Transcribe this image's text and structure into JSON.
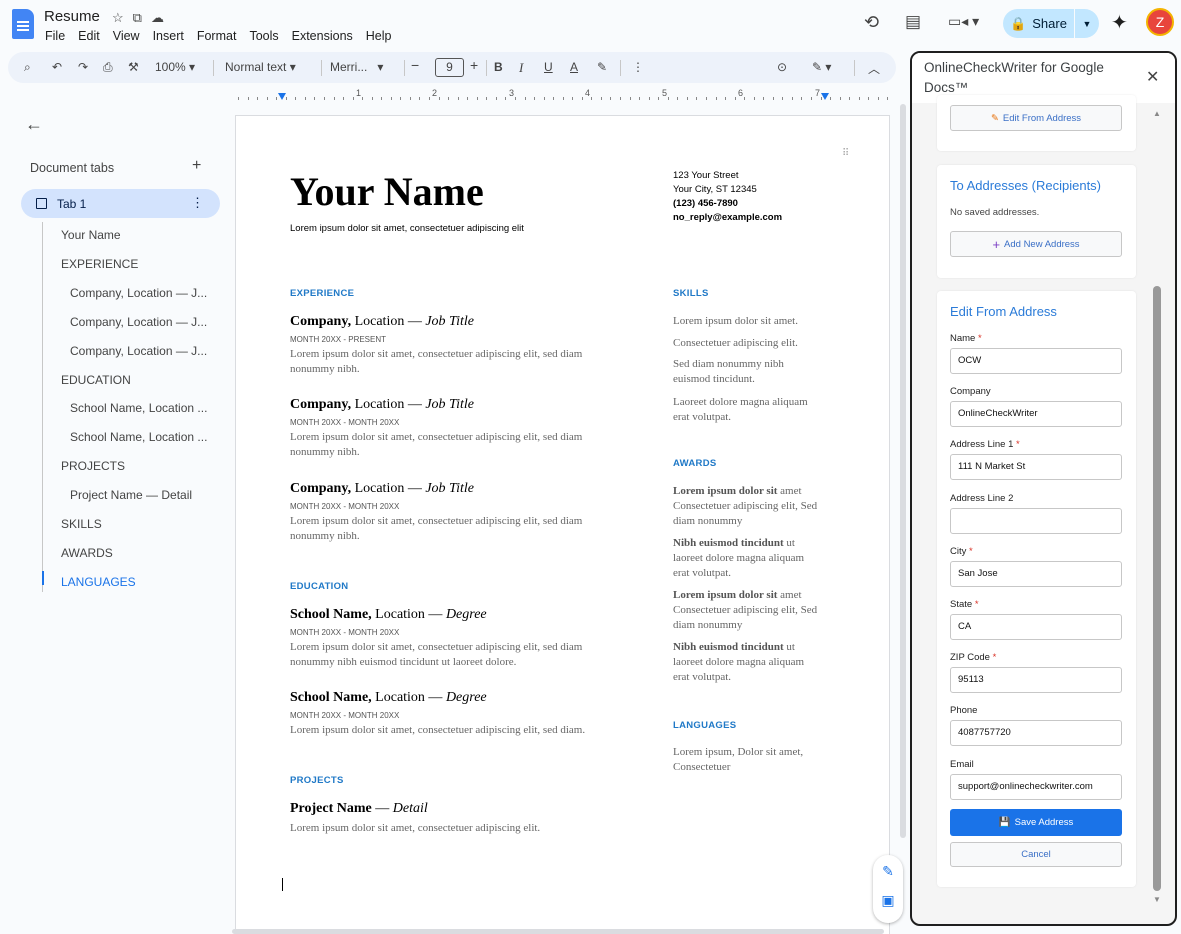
{
  "app": {
    "doc_title": "Resume",
    "menus": [
      "File",
      "Edit",
      "View",
      "Insert",
      "Format",
      "Tools",
      "Extensions",
      "Help"
    ],
    "share_label": "Share",
    "avatar_letter": "Z"
  },
  "toolbar": {
    "zoom": "100%",
    "style": "Normal text",
    "font": "Merri...",
    "font_size": "9"
  },
  "ruler": {
    "marks": [
      "1",
      "2",
      "3",
      "4",
      "5",
      "6",
      "7"
    ]
  },
  "left_pane": {
    "heading": "Document tabs",
    "tab_label": "Tab 1",
    "outline": [
      {
        "label": "Your Name",
        "level": 1
      },
      {
        "label": "EXPERIENCE",
        "level": 1
      },
      {
        "label": "Company, Location — J...",
        "level": 2
      },
      {
        "label": "Company, Location — J...",
        "level": 2
      },
      {
        "label": "Company, Location — J...",
        "level": 2
      },
      {
        "label": "EDUCATION",
        "level": 1
      },
      {
        "label": "School Name, Location ...",
        "level": 2
      },
      {
        "label": "School Name, Location ...",
        "level": 2
      },
      {
        "label": "PROJECTS",
        "level": 1
      },
      {
        "label": "Project Name — Detail",
        "level": 2
      },
      {
        "label": "SKILLS",
        "level": 1
      },
      {
        "label": "AWARDS",
        "level": 1
      },
      {
        "label": "LANGUAGES",
        "level": 1
      }
    ]
  },
  "doc": {
    "name": "Your Name",
    "tagline": "Lorem ipsum dolor sit amet, consectetuer adipiscing elit",
    "contact": [
      "123 Your Street",
      "Your City, ST 12345",
      "(123) 456-7890",
      "no_reply@example.com"
    ],
    "experience_head": "EXPERIENCE",
    "jobs": [
      {
        "company": "Company,",
        "location": " Location — ",
        "title": "Job Title",
        "dates": "MONTH 20XX - PRESENT",
        "desc": "Lorem ipsum dolor sit amet, consectetuer adipiscing elit, sed diam nonummy nibh."
      },
      {
        "company": "Company,",
        "location": " Location — ",
        "title": "Job Title",
        "dates": "MONTH 20XX - MONTH 20XX",
        "desc": "Lorem ipsum dolor sit amet, consectetuer adipiscing elit, sed diam nonummy nibh."
      },
      {
        "company": "Company,",
        "location": " Location — ",
        "title": "Job Title",
        "dates": "MONTH 20XX - MONTH 20XX",
        "desc": "Lorem ipsum dolor sit amet, consectetuer adipiscing elit, sed diam nonummy nibh."
      }
    ],
    "education_head": "EDUCATION",
    "schools": [
      {
        "school": "School Name,",
        "location": " Location — ",
        "degree": "Degree",
        "dates": "MONTH 20XX - MONTH 20XX",
        "desc": "Lorem ipsum dolor sit amet, consectetuer adipiscing elit, sed diam nonummy nibh euismod tincidunt ut laoreet dolore."
      },
      {
        "school": "School Name,",
        "location": " Location — ",
        "degree": "Degree",
        "dates": "MONTH 20XX - MONTH 20XX",
        "desc": "Lorem ipsum dolor sit amet, consectetuer adipiscing elit, sed diam."
      }
    ],
    "projects_head": "PROJECTS",
    "project": {
      "name": "Project Name",
      "detail": " — ",
      "detail_italic": "Detail",
      "desc": "Lorem ipsum dolor sit amet, consectetuer adipiscing elit."
    },
    "skills_head": "SKILLS",
    "skills": [
      "Lorem ipsum dolor sit amet.",
      "Consectetuer adipiscing elit.",
      "Sed diam nonummy nibh euismod tincidunt.",
      "Laoreet dolore magna aliquam erat volutpat."
    ],
    "awards_head": "AWARDS",
    "awards": [
      {
        "bold": "Lorem ipsum dolor sit",
        "rest": " amet Consectetuer adipiscing elit, Sed diam nonummy"
      },
      {
        "bold": "Nibh euismod tincidunt",
        "rest": " ut laoreet dolore magna aliquam erat volutpat."
      },
      {
        "bold": "Lorem ipsum dolor sit",
        "rest": " amet Consectetuer adipiscing elit, Sed diam nonummy"
      },
      {
        "bold": "Nibh euismod tincidunt",
        "rest": " ut laoreet dolore magna aliquam erat volutpat."
      }
    ],
    "languages_head": "LANGUAGES",
    "languages": "Lorem ipsum, Dolor sit amet, Consectetuer"
  },
  "sidebar": {
    "title": "OnlineCheckWriter for Google Docs™",
    "edit_from_btn": "Edit From Address",
    "to_title": "To Addresses (Recipients)",
    "no_saved": "No saved addresses.",
    "add_new_btn": "Add New Address",
    "form_title": "Edit From Address",
    "fields": [
      {
        "label": "Name",
        "required": "*",
        "value": "OCW"
      },
      {
        "label": "Company",
        "required": "",
        "value": "OnlineCheckWriter"
      },
      {
        "label": "Address Line 1",
        "required": "*",
        "value": "111 N Market St"
      },
      {
        "label": "Address Line 2",
        "required": "",
        "value": ""
      },
      {
        "label": "City",
        "required": "*",
        "value": "San Jose"
      },
      {
        "label": "State",
        "required": "*",
        "value": "CA"
      },
      {
        "label": "ZIP Code",
        "required": "*",
        "value": "95113"
      },
      {
        "label": "Phone",
        "required": "",
        "value": "4087757720"
      },
      {
        "label": "Email",
        "required": "",
        "value": "support@onlinecheckwriter.com"
      }
    ],
    "save_btn": "Save Address",
    "cancel_btn": "Cancel"
  }
}
